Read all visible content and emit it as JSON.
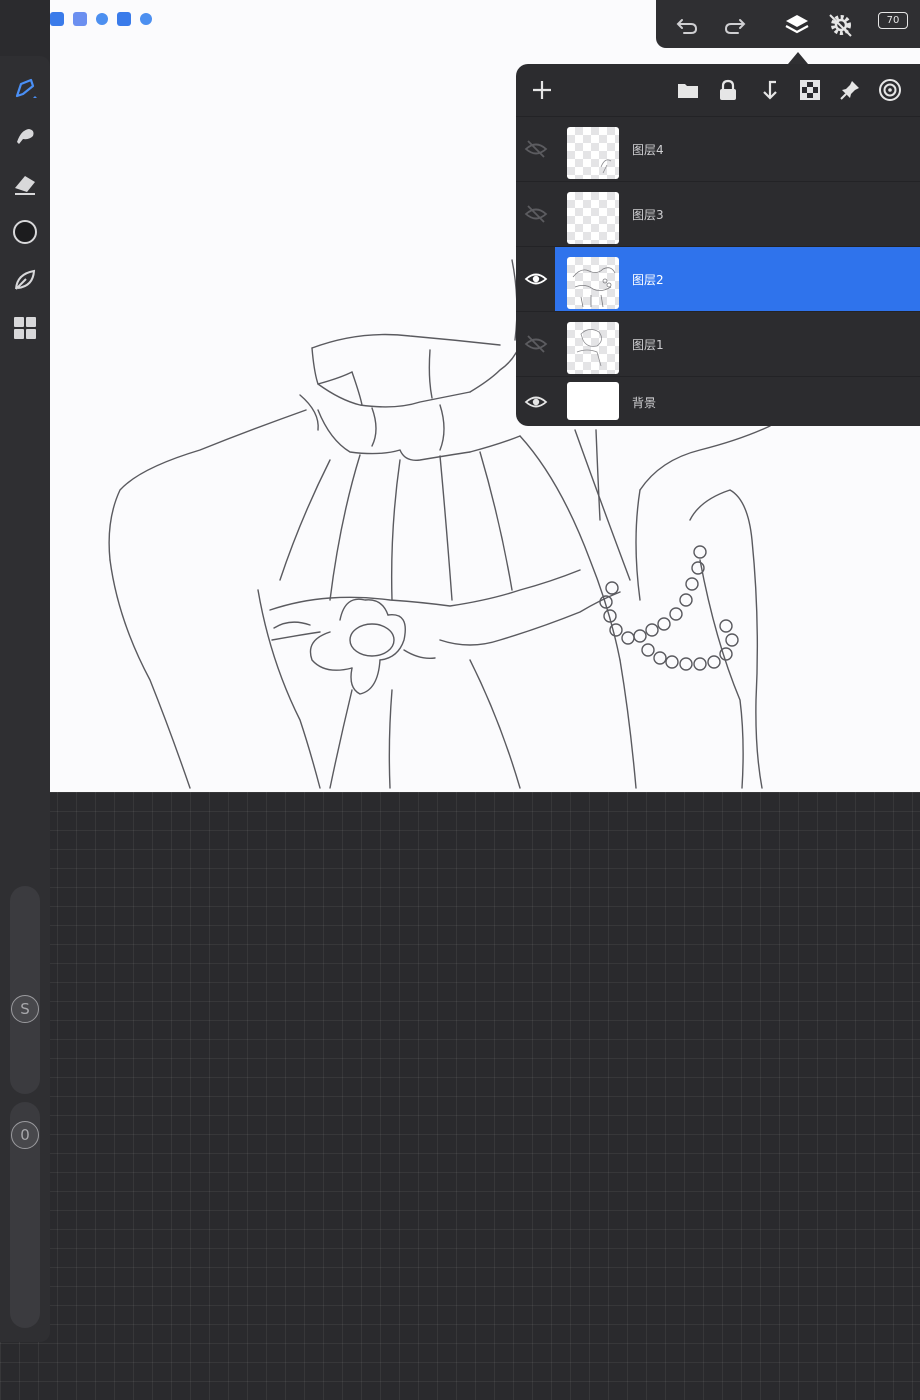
{
  "toolbar": {
    "undo_icon": "undo-icon",
    "redo_icon": "redo-icon",
    "layers_icon": "layers-icon",
    "battery_level": "70"
  },
  "left_tools": [
    "brush-icon",
    "smudge-icon",
    "eraser-icon",
    "color-icon",
    "leaf-icon",
    "gallery-icon"
  ],
  "sliders": {
    "size_label": "S",
    "opacity_label": "0"
  },
  "layers_panel": {
    "actions": [
      "add-layer-icon",
      "folder-icon",
      "lock-icon",
      "merge-down-icon",
      "checker-icon",
      "pin-icon",
      "target-icon"
    ],
    "layers": [
      {
        "name": "图层4",
        "visible": false,
        "selected": false
      },
      {
        "name": "图层3",
        "visible": false,
        "selected": false
      },
      {
        "name": "图层2",
        "visible": true,
        "selected": true
      },
      {
        "name": "图层1",
        "visible": false,
        "selected": false
      },
      {
        "name": "背景",
        "visible": true,
        "selected": false
      }
    ]
  },
  "colors": {
    "accent": "#2f73ec",
    "panel": "#2c2c2f",
    "canvas": "#fbfbfd"
  }
}
